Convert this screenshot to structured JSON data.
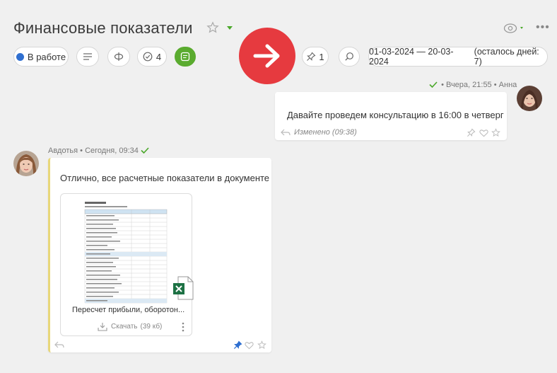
{
  "header": {
    "title": "Финансовые показатели"
  },
  "toolbar": {
    "status_label": "В работе",
    "checks_count": "4",
    "pins_count": "1",
    "date_range": "01-03-2024 — 20-03-2024",
    "days_left": "(осталось дней: 7)"
  },
  "messages": [
    {
      "author": "Анна",
      "time": "Вчера, 21:55",
      "text": "Давайте проведем консультацию в 16:00 в четверг",
      "edited": "Изменено (09:38)"
    },
    {
      "author": "Авдотья",
      "time": "Сегодня, 09:34",
      "text": "Отлично, все расчетные показатели в документе",
      "attachment": {
        "name": "Пересчет прибыли, оборотон...",
        "download_label": "Скачать",
        "size": "(39 кб)"
      }
    }
  ],
  "colors": {
    "accent_green": "#5aab2f",
    "status_blue": "#2f6fd0",
    "arrow_red": "#e63a3f",
    "quote_bar": "#e8d77a"
  }
}
